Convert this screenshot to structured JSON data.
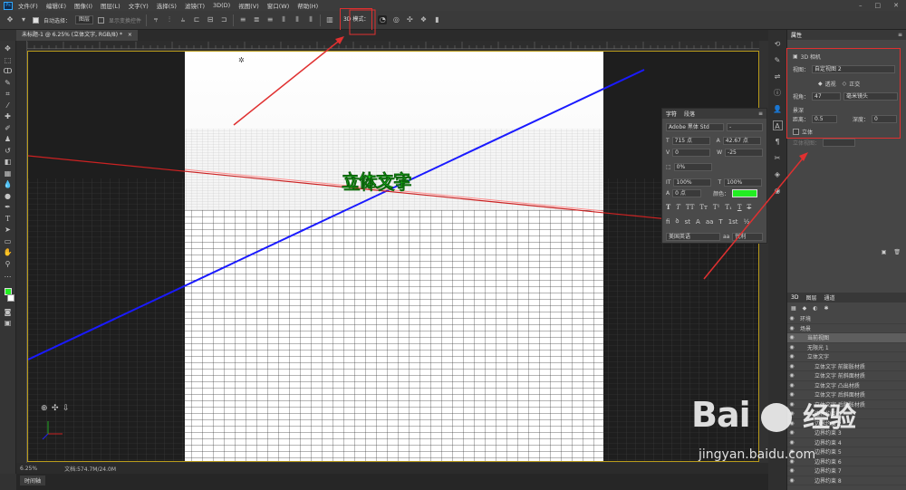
{
  "menu": {
    "items": [
      "文件(F)",
      "编辑(E)",
      "图像(I)",
      "图层(L)",
      "文字(Y)",
      "选择(S)",
      "滤镜(T)",
      "3D(D)",
      "视图(V)",
      "窗口(W)",
      "帮助(H)"
    ],
    "app_logo": "Ps"
  },
  "options": {
    "auto_select_label": "自动选择：",
    "auto_select_value": "图层",
    "transform_label": "显示变换控件",
    "mode_3d_label": "3D 模式："
  },
  "document": {
    "tab_title": "未标题-1 @ 6.25% (立体文字, RGB/8) *",
    "zoom": "6.25%",
    "doc_info": "文档:574.7M/24.0M",
    "text_3d": "立体文字"
  },
  "timeline": {
    "label": "时间轴"
  },
  "properties": {
    "title": "属性",
    "camera_label": "3D 相机",
    "view_label": "视图：",
    "view_value": "自定视图 2",
    "perspective_label": "透视",
    "ortho_label": "正交",
    "fov_label": "视角：",
    "fov_value": "47",
    "fov_unit": "毫米镜头",
    "dof_label": "景深",
    "distance_label": "距离：",
    "distance_value": "0.5",
    "depth_label": "深度：",
    "depth_value": "0",
    "stereo_label": "立体",
    "stereo_view_label": "立体视图："
  },
  "character": {
    "tabs": [
      "字符",
      "段落"
    ],
    "font_family": "Adobe 黑体 Std",
    "font_style": "-",
    "font_size": "715 点",
    "leading": "42.67 点",
    "kerning": "0",
    "tracking": "-25",
    "scale_pct": "0%",
    "vscale": "100%",
    "hscale": "100%",
    "baseline": "0 点",
    "color_label": "颜色：",
    "color_hex": "#22ee22",
    "language": "美国英语",
    "antialias": "锐利"
  },
  "layers_panel": {
    "tabs": [
      "3D",
      "图层",
      "通道"
    ],
    "rows": [
      {
        "label": "环境",
        "indent": 0
      },
      {
        "label": "场景",
        "indent": 0
      },
      {
        "label": "当前视图",
        "indent": 1,
        "selected": true
      },
      {
        "label": "无限光 1",
        "indent": 1
      },
      {
        "label": "立体文字",
        "indent": 1
      },
      {
        "label": "立体文字 前膨胀材质",
        "indent": 2
      },
      {
        "label": "立体文字 前斜面材质",
        "indent": 2
      },
      {
        "label": "立体文字 凸出材质",
        "indent": 2
      },
      {
        "label": "立体文字 后斜面材质",
        "indent": 2
      },
      {
        "label": "立体文字 后膨胀材质",
        "indent": 2
      },
      {
        "label": "边界约束 1",
        "indent": 2
      },
      {
        "label": "边界约束 2",
        "indent": 2
      },
      {
        "label": "边界约束 3",
        "indent": 2
      },
      {
        "label": "边界约束 4",
        "indent": 2
      },
      {
        "label": "边界约束 5",
        "indent": 2
      },
      {
        "label": "边界约束 6",
        "indent": 2
      },
      {
        "label": "边界约束 7",
        "indent": 2
      },
      {
        "label": "边界约束 8",
        "indent": 2
      }
    ]
  },
  "watermark": {
    "brand": "Bai",
    "brand2": "经验",
    "url": "jingyan.baidu.com"
  },
  "colors": {
    "annotation_red": "#e03030",
    "text_green": "#22ee22",
    "axis_blue": "#1a1aff",
    "axis_red": "#cc2222"
  }
}
